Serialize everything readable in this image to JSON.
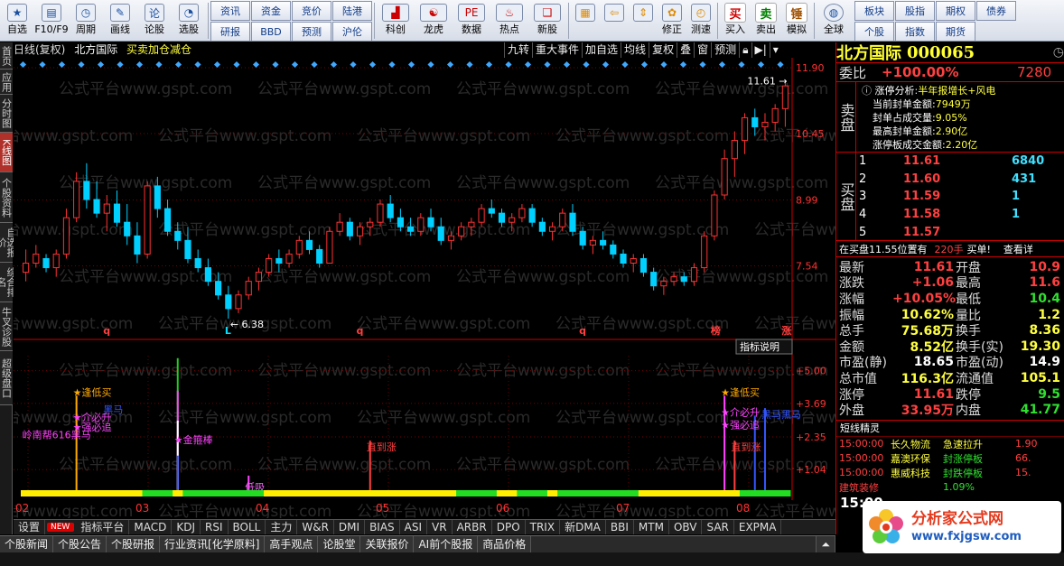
{
  "toolbar": {
    "left": [
      {
        "label": "自选",
        "icon": "star-icon"
      },
      {
        "label": "F10/F9",
        "icon": "f10-icon"
      },
      {
        "label": "周期",
        "icon": "clock-icon"
      },
      {
        "label": "画线",
        "icon": "pencil-icon"
      },
      {
        "label": "论股",
        "icon": "forum-icon"
      },
      {
        "label": "选股",
        "icon": "filter-icon"
      }
    ],
    "grid1": [
      "资讯",
      "资金",
      "竞价",
      "陆港",
      "研报",
      "BBD",
      "预测",
      "沪伦"
    ],
    "mid": [
      {
        "label": "科创",
        "icon": "chart-icon"
      },
      {
        "label": "龙虎",
        "icon": "dragon-icon"
      },
      {
        "label": "数据",
        "icon": "pe-icon"
      },
      {
        "label": "热点",
        "icon": "hot-icon"
      },
      {
        "label": "新股",
        "icon": "ipo-icon"
      }
    ],
    "tools": [
      {
        "label": "",
        "icon": "grid-icon"
      },
      {
        "label": "",
        "icon": "arrow-left-icon"
      },
      {
        "label": "",
        "icon": "updown-icon"
      },
      {
        "label": "修正",
        "icon": "fix-icon"
      },
      {
        "label": "测速",
        "icon": "speed-icon"
      }
    ],
    "trade": [
      {
        "label": "买入",
        "char": "买",
        "color": "#d00000"
      },
      {
        "label": "卖出",
        "char": "卖",
        "color": "#008000"
      },
      {
        "label": "模拟",
        "char": "锤",
        "color": "#a05000"
      }
    ],
    "globe": "全球",
    "grid2": [
      "板块",
      "股指",
      "期权",
      "债券",
      "个股",
      "指数",
      "期货"
    ]
  },
  "leftbar": [
    {
      "text": "首页",
      "on": false
    },
    {
      "text": "应用",
      "on": false
    },
    {
      "text": "分时图",
      "on": false
    },
    {
      "text": "K线图",
      "on": true
    },
    {
      "text": "个股资料",
      "on": false
    },
    {
      "text": "自选报价",
      "on": false
    },
    {
      "text": "综合排名",
      "on": false
    },
    {
      "text": "牛叉诊股",
      "on": false
    },
    {
      "text": "超级盘口",
      "on": false
    }
  ],
  "chart_header": {
    "period": "日线(复权)",
    "name": "北方国际",
    "signal": "买卖加仓减仓"
  },
  "chart_tools": [
    "九转",
    "重大事件",
    "加自选",
    "均线",
    "复权",
    "叠",
    "窗",
    "预测"
  ],
  "chart_data": {
    "type": "candlestick",
    "ylim": [
      6.2,
      12.0
    ],
    "yticks": [
      "11.90",
      "10.45",
      "8.99",
      "7.54"
    ],
    "xticks": [
      "02",
      "03",
      "04",
      "05",
      "06",
      "07",
      "08"
    ],
    "high_label": "11.61",
    "low_label": "6.38",
    "ohlc": [
      [
        7.4,
        7.9,
        7.2,
        7.6
      ],
      [
        7.6,
        8.0,
        7.5,
        7.8
      ],
      [
        7.7,
        7.8,
        7.4,
        7.5
      ],
      [
        7.5,
        7.9,
        7.3,
        7.8
      ],
      [
        7.8,
        8.8,
        7.7,
        8.6
      ],
      [
        8.6,
        9.6,
        8.5,
        9.4
      ],
      [
        9.4,
        9.8,
        8.8,
        9.0
      ],
      [
        9.0,
        9.4,
        8.6,
        8.7
      ],
      [
        8.7,
        9.1,
        8.3,
        8.9
      ],
      [
        8.9,
        9.2,
        8.4,
        8.5
      ],
      [
        8.5,
        8.9,
        8.0,
        8.2
      ],
      [
        8.2,
        8.5,
        7.6,
        7.8
      ],
      [
        7.8,
        9.4,
        7.7,
        9.3
      ],
      [
        9.3,
        9.5,
        8.6,
        8.8
      ],
      [
        8.8,
        9.0,
        8.2,
        8.3
      ],
      [
        8.3,
        8.5,
        7.9,
        8.1
      ],
      [
        8.1,
        8.4,
        7.6,
        7.7
      ],
      [
        7.7,
        7.9,
        7.4,
        7.5
      ],
      [
        7.5,
        7.7,
        7.1,
        7.2
      ],
      [
        7.2,
        7.4,
        6.8,
        6.9
      ],
      [
        6.9,
        7.1,
        6.38,
        6.6
      ],
      [
        6.6,
        7.0,
        6.5,
        6.9
      ],
      [
        6.9,
        7.3,
        6.8,
        7.2
      ],
      [
        7.2,
        7.5,
        7.0,
        7.4
      ],
      [
        7.4,
        7.8,
        7.3,
        7.7
      ],
      [
        7.7,
        7.9,
        7.4,
        7.6
      ],
      [
        7.6,
        7.9,
        7.5,
        7.8
      ],
      [
        7.8,
        8.2,
        7.7,
        8.1
      ],
      [
        8.1,
        8.3,
        7.8,
        7.9
      ],
      [
        7.9,
        8.0,
        7.5,
        7.6
      ],
      [
        7.6,
        8.4,
        7.6,
        8.3
      ],
      [
        8.3,
        8.7,
        8.2,
        8.5
      ],
      [
        8.5,
        8.6,
        8.1,
        8.2
      ],
      [
        8.2,
        8.5,
        8.0,
        8.4
      ],
      [
        8.4,
        8.6,
        8.2,
        8.5
      ],
      [
        8.5,
        9.0,
        8.4,
        8.9
      ],
      [
        8.9,
        9.1,
        8.5,
        8.6
      ],
      [
        8.6,
        8.8,
        8.3,
        8.4
      ],
      [
        8.4,
        8.6,
        8.2,
        8.3
      ],
      [
        8.3,
        8.7,
        8.2,
        8.6
      ],
      [
        8.6,
        8.8,
        8.3,
        8.4
      ],
      [
        8.4,
        8.6,
        8.0,
        8.1
      ],
      [
        8.1,
        8.3,
        7.9,
        8.2
      ],
      [
        8.2,
        8.5,
        8.1,
        8.4
      ],
      [
        8.4,
        8.6,
        8.2,
        8.5
      ],
      [
        8.5,
        8.9,
        8.4,
        8.8
      ],
      [
        8.8,
        9.0,
        8.6,
        8.7
      ],
      [
        8.7,
        8.8,
        8.4,
        8.5
      ],
      [
        8.5,
        8.7,
        8.3,
        8.6
      ],
      [
        8.6,
        8.9,
        8.5,
        8.8
      ],
      [
        8.8,
        8.9,
        8.4,
        8.5
      ],
      [
        8.5,
        8.6,
        8.2,
        8.3
      ],
      [
        8.3,
        8.5,
        8.1,
        8.4
      ],
      [
        8.4,
        8.8,
        8.3,
        8.7
      ],
      [
        8.7,
        8.9,
        8.2,
        8.3
      ],
      [
        8.3,
        8.4,
        7.9,
        8.0
      ],
      [
        8.0,
        8.2,
        7.8,
        8.1
      ],
      [
        8.1,
        8.3,
        7.9,
        8.0
      ],
      [
        8.0,
        8.1,
        7.7,
        7.8
      ],
      [
        7.8,
        7.9,
        7.5,
        7.6
      ],
      [
        7.6,
        7.8,
        7.4,
        7.7
      ],
      [
        7.7,
        7.8,
        7.3,
        7.4
      ],
      [
        7.4,
        7.5,
        7.0,
        7.1
      ],
      [
        7.1,
        7.3,
        6.9,
        7.2
      ],
      [
        7.2,
        7.4,
        7.1,
        7.3
      ],
      [
        7.3,
        7.4,
        7.1,
        7.2
      ],
      [
        7.2,
        7.6,
        7.1,
        7.5
      ],
      [
        7.5,
        8.3,
        7.4,
        8.2
      ],
      [
        8.2,
        9.2,
        8.1,
        9.1
      ],
      [
        9.1,
        10.1,
        9.0,
        9.9
      ],
      [
        9.9,
        10.5,
        9.5,
        10.3
      ],
      [
        10.3,
        10.9,
        10.0,
        10.8
      ],
      [
        10.8,
        11.0,
        10.4,
        10.6
      ],
      [
        10.6,
        10.9,
        10.3,
        10.7
      ],
      [
        10.7,
        11.1,
        10.5,
        11.0
      ],
      [
        11.0,
        11.61,
        10.6,
        11.5
      ]
    ],
    "markers": [
      {
        "i": 20,
        "t": "L",
        "c": "#00e0ff"
      },
      {
        "i": 8,
        "t": "q",
        "c": "#ff4040"
      },
      {
        "i": 33,
        "t": "q",
        "c": "#ff4040"
      },
      {
        "i": 55,
        "t": "q",
        "c": "#ff4040"
      },
      {
        "i": 68,
        "t": "榜",
        "c": "#ff4040"
      },
      {
        "i": 75,
        "t": "涨",
        "c": "#ff4040"
      }
    ],
    "indicator": {
      "ylim": [
        0,
        5.6
      ],
      "yticks": [
        "5.00",
        "3.69",
        "2.35",
        "1.04"
      ],
      "button": "指标说明",
      "labels": [
        {
          "text": "★逢低买",
          "c": "#ffaa00",
          "i": 5,
          "v": 4.0
        },
        {
          "text": "★介必升",
          "c": "#ff44ff",
          "i": 5,
          "v": 3.0
        },
        {
          "text": "★强必追",
          "c": "#ff44ff",
          "i": 5,
          "v": 2.6
        },
        {
          "text": "黑马",
          "c": "#3355ff",
          "i": 8,
          "v": 3.3
        },
        {
          "text": "岭南帮616黑马",
          "c": "#ff44ff",
          "i": 0,
          "v": 2.3
        },
        {
          "text": "★金箍棒",
          "c": "#ff44ff",
          "i": 15,
          "v": 2.1
        },
        {
          "text": "低吸",
          "c": "#ff66ff",
          "i": 22,
          "v": 0.2
        },
        {
          "text": "直到涨",
          "c": "#ff4040",
          "i": 34,
          "v": 1.8
        },
        {
          "text": "★逢低买",
          "c": "#ffaa00",
          "i": 69,
          "v": 4.0
        },
        {
          "text": "★介必升",
          "c": "#ff44ff",
          "i": 69,
          "v": 3.2
        },
        {
          "text": "★强必追",
          "c": "#ff44ff",
          "i": 69,
          "v": 2.7
        },
        {
          "text": "直到涨",
          "c": "#ff4040",
          "i": 70,
          "v": 1.8
        },
        {
          "text": "黑马黑马",
          "c": "#3355ff",
          "i": 73,
          "v": 3.1
        }
      ],
      "bars": [
        {
          "i": 5,
          "v": 4.0,
          "c": "#ffaa00"
        },
        {
          "i": 15,
          "v": 5.5,
          "c": "#22cc22"
        },
        {
          "i": 15,
          "v": 4.2,
          "c": "#ff44ff"
        },
        {
          "i": 15,
          "v": 3.0,
          "c": "#ffffff"
        },
        {
          "i": 15,
          "v": 1.6,
          "c": "#3355ff"
        },
        {
          "i": 22,
          "v": 0.8,
          "c": "#ff44ff"
        },
        {
          "i": 34,
          "v": 2.2,
          "c": "#ff4040"
        },
        {
          "i": 69,
          "v": 4.0,
          "c": "#ff44ff"
        },
        {
          "i": 70,
          "v": 2.2,
          "c": "#ff4040"
        },
        {
          "i": 72,
          "v": 3.2,
          "c": "#3355ff"
        },
        {
          "i": 73,
          "v": 3.5,
          "c": "#3355ff"
        }
      ]
    }
  },
  "quote": {
    "name": "北方国际",
    "code": "000065",
    "weibi": {
      "label": "委比",
      "value": "+100.00%",
      "extra": "7280"
    },
    "sell_label": "卖盘",
    "limit": {
      "title": "涨停分析",
      "reason": "半年报增长+风电",
      "lines": [
        [
          "当前封单金额:",
          "7949万"
        ],
        [
          "封单占成交量:",
          "9.05%"
        ],
        [
          "最高封单金额:",
          "2.90亿"
        ],
        [
          "涨停板成交金额:",
          "2.20亿"
        ]
      ]
    },
    "buy_label": "买盘",
    "bids": [
      [
        "1",
        "11.61",
        "6840"
      ],
      [
        "2",
        "11.60",
        "431"
      ],
      [
        "3",
        "11.59",
        "1"
      ],
      [
        "4",
        "11.58",
        "1"
      ],
      [
        "5",
        "11.57",
        ""
      ]
    ],
    "info": {
      "text": "在买盘11.55位置有",
      "vol": "220手",
      "act": "买单!",
      "more": "查看详"
    },
    "stats": [
      [
        "最新",
        "11.61",
        "red",
        "开盘",
        "10.9",
        "red"
      ],
      [
        "涨跌",
        "+1.06",
        "red",
        "最高",
        "11.6",
        "red"
      ],
      [
        "涨幅",
        "+10.05%",
        "red",
        "最低",
        "10.4",
        "grn"
      ],
      [
        "振幅",
        "10.62%",
        "yel",
        "量比",
        "1.2",
        "yel"
      ],
      [
        "总手",
        "75.68万",
        "yel",
        "换手",
        "8.36",
        "yel"
      ],
      [
        "金额",
        "8.52亿",
        "yel",
        "换手(实)",
        "19.30",
        "yel"
      ],
      [
        "市盈(静)",
        "18.65",
        "white",
        "市盈(动)",
        "14.9",
        "white"
      ],
      [
        "总市值",
        "116.3亿",
        "yel",
        "流通值",
        "105.1",
        "yel"
      ],
      [
        "涨停",
        "11.61",
        "red",
        "跌停",
        "9.5",
        "grn"
      ],
      [
        "外盘",
        "33.95万",
        "red",
        "内盘",
        "41.77",
        "grn"
      ]
    ],
    "short_title": "短线精灵",
    "short": [
      [
        "15:00:00",
        "长久物流",
        "急速拉升",
        "1.90"
      ],
      [
        "15:00:00",
        "嘉澳环保",
        "封涨停板",
        "66."
      ],
      [
        "15:00:00",
        "惠威科技",
        "封跌停板",
        "15."
      ],
      [
        "建筑装修",
        "",
        "1.09%",
        ""
      ]
    ],
    "time": "15:00"
  },
  "indtabs": [
    "设置",
    "NEW",
    "指标平台",
    "MACD",
    "KDJ",
    "RSI",
    "BOLL",
    "主力",
    "W&R",
    "DMI",
    "BIAS",
    "ASI",
    "VR",
    "ARBR",
    "DPO",
    "TRIX",
    "新DMA",
    "BBI",
    "MTM",
    "OBV",
    "SAR",
    "EXPMA"
  ],
  "newsbar": [
    "个股新闻",
    "个股公告",
    "个股研报",
    "行业资讯[化学原料]",
    "高手观点",
    "论股堂",
    "关联报价",
    "AI前个股报",
    "商品价格"
  ],
  "watermark": {
    "title": "分析家公式网",
    "url": "www.fxjgsw.com",
    "bg": "公式平台www.gspt.com"
  },
  "colors": {
    "up": "#ff3232",
    "down": "#00d0ff",
    "grid": "#7a0000"
  }
}
